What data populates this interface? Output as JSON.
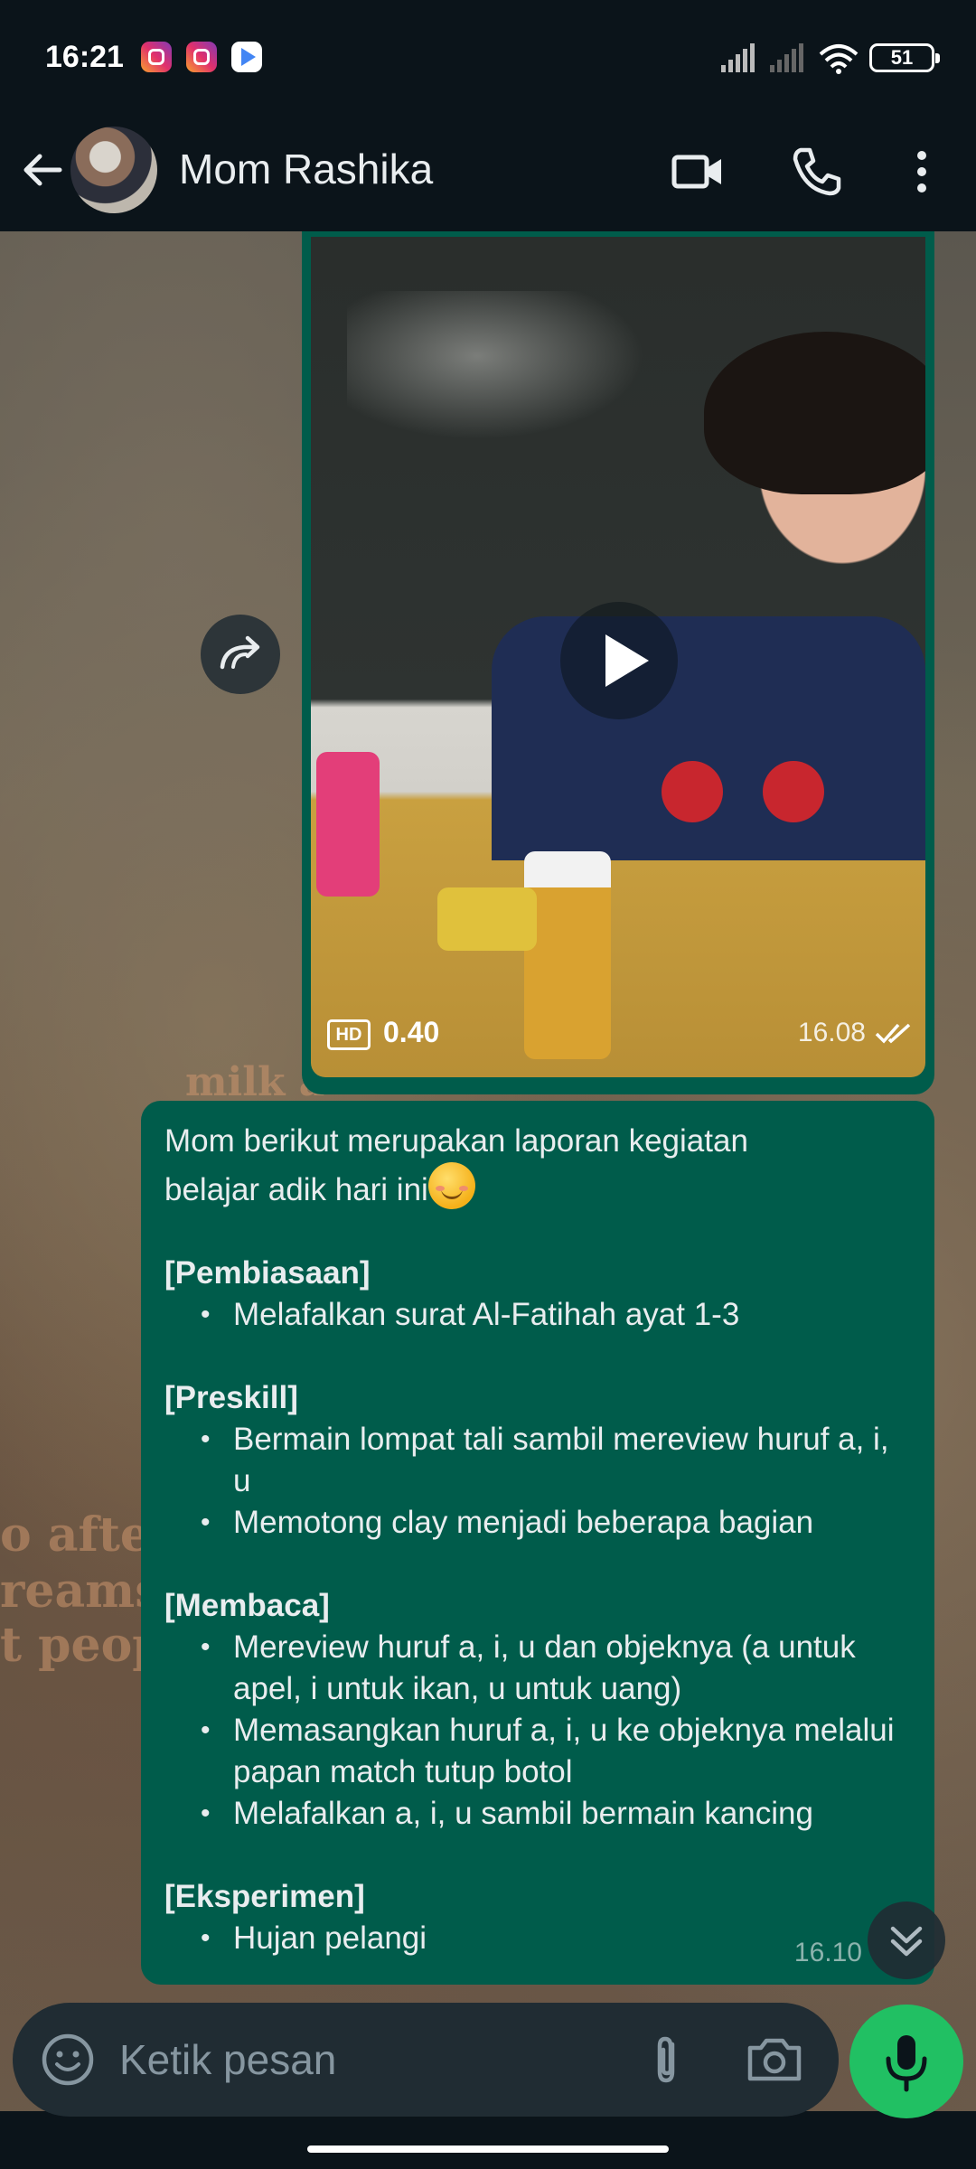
{
  "status_bar": {
    "time": "16:21",
    "notifications": [
      "instagram-icon",
      "instagram-icon",
      "google-play-icon"
    ],
    "battery": "51"
  },
  "header": {
    "contact_name": "Mom Rashika",
    "icons": [
      "back-arrow-icon",
      "video-call-icon",
      "phone-icon",
      "more-vertical-icon"
    ]
  },
  "video_message": {
    "quality_badge": "HD",
    "duration": "0.40",
    "time": "16.08",
    "status": "read"
  },
  "text_message": {
    "intro_line1": "Mom berikut merupakan laporan kegiatan",
    "intro_line2": "belajar adik hari ini",
    "emoji": "smiling-face-emoji",
    "sections": [
      {
        "title": "[Pembiasaan]",
        "items": [
          "Melafalkan surat Al-Fatihah ayat 1-3"
        ]
      },
      {
        "title": "[Preskill]",
        "items": [
          "Bermain lompat tali sambil mereview huruf a, i, u",
          "Memotong clay menjadi beberapa bagian"
        ]
      },
      {
        "title": "[Membaca]",
        "items": [
          "Mereview huruf a, i, u dan objeknya (a untuk apel, i untuk ikan, u untuk uang)",
          "Memasangkan huruf a, i, u ke objeknya melalui papan match tutup botol",
          "Melafalkan a, i, u sambil bermain kancing"
        ]
      },
      {
        "title": "[Eksperimen]",
        "items": [
          "Hujan pelangi"
        ]
      }
    ],
    "time": "16.10"
  },
  "wallpaper_text": {
    "line1": "milk a",
    "line2": "o after",
    "line3": "reams",
    "line4": "t peopl"
  },
  "composer": {
    "placeholder": "Ketik pesan"
  },
  "colors": {
    "header_bg": "#0b141a",
    "outgoing_bubble": "#005c4b",
    "input_bg": "#202c33",
    "mic_button": "#21c063"
  }
}
